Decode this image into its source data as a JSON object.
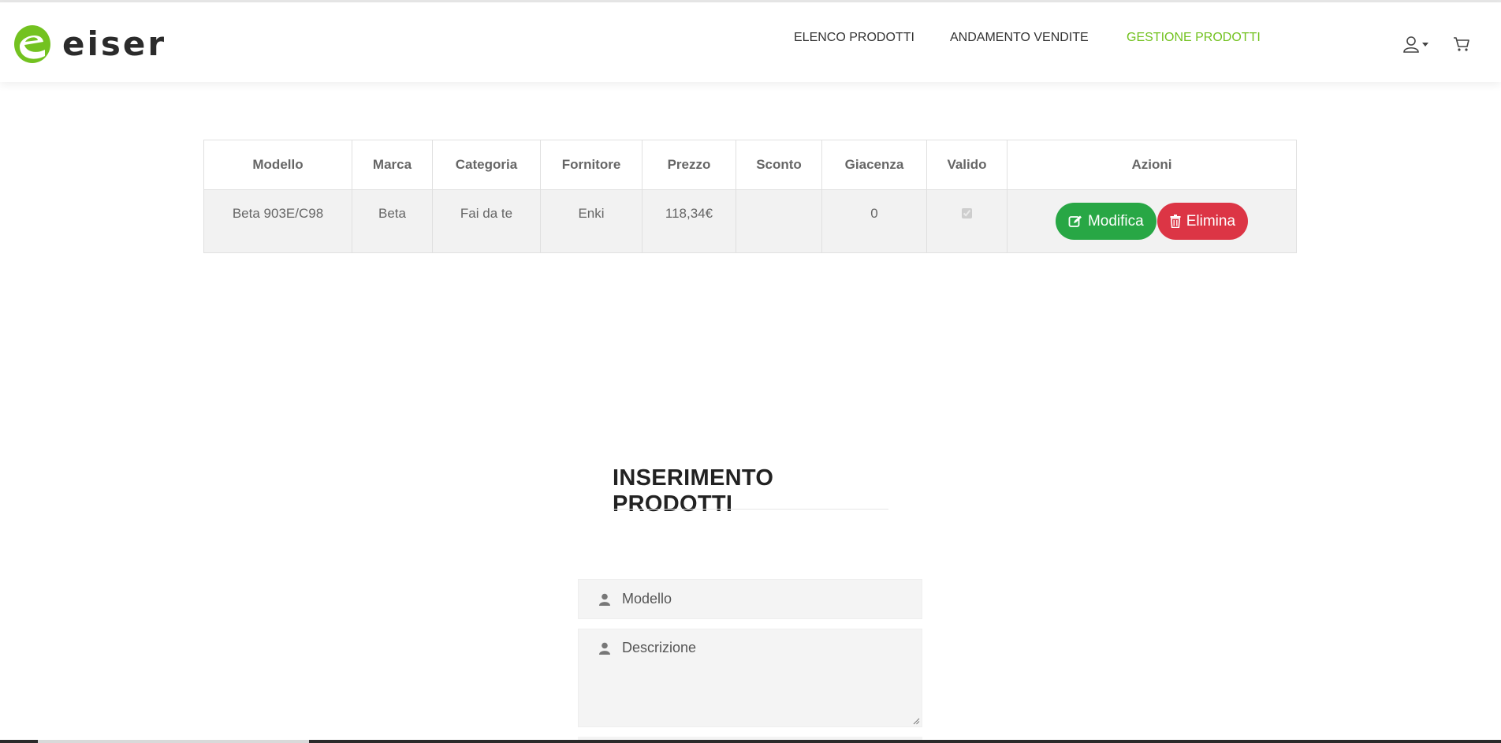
{
  "brand": {
    "name": "eiser",
    "accent_color": "#73c220",
    "logo_icon": "eiser-logo-icon"
  },
  "nav": {
    "items": [
      {
        "label": "ELENCO PRODOTTI",
        "active": false
      },
      {
        "label": "ANDAMENTO VENDITE",
        "active": false
      },
      {
        "label": "GESTIONE PRODOTTI",
        "active": true
      }
    ],
    "user_icon": "user-icon",
    "cart_icon": "cart-icon"
  },
  "products_table": {
    "columns": [
      "Modello",
      "Marca",
      "Categoria",
      "Fornitore",
      "Prezzo",
      "Sconto",
      "Giacenza",
      "Valido",
      "Azioni"
    ],
    "rows": [
      {
        "modello": "Beta 903E/C98",
        "marca": "Beta",
        "categoria": "Fai da te",
        "fornitore": "Enki",
        "prezzo": "118,34€",
        "sconto": "",
        "giacenza": "0",
        "valido": true,
        "actions": {
          "edit_label": "Modifica",
          "edit_icon": "edit-icon",
          "edit_color": "#28a745",
          "delete_label": "Elimina",
          "delete_icon": "trash-icon",
          "delete_color": "#dc3545"
        }
      }
    ]
  },
  "insert_form": {
    "title": "INSERIMENTO PRODOTTI",
    "fields": {
      "model_placeholder": "Modello",
      "description_placeholder": "Descrizione",
      "field_icon": "user-icon"
    }
  }
}
